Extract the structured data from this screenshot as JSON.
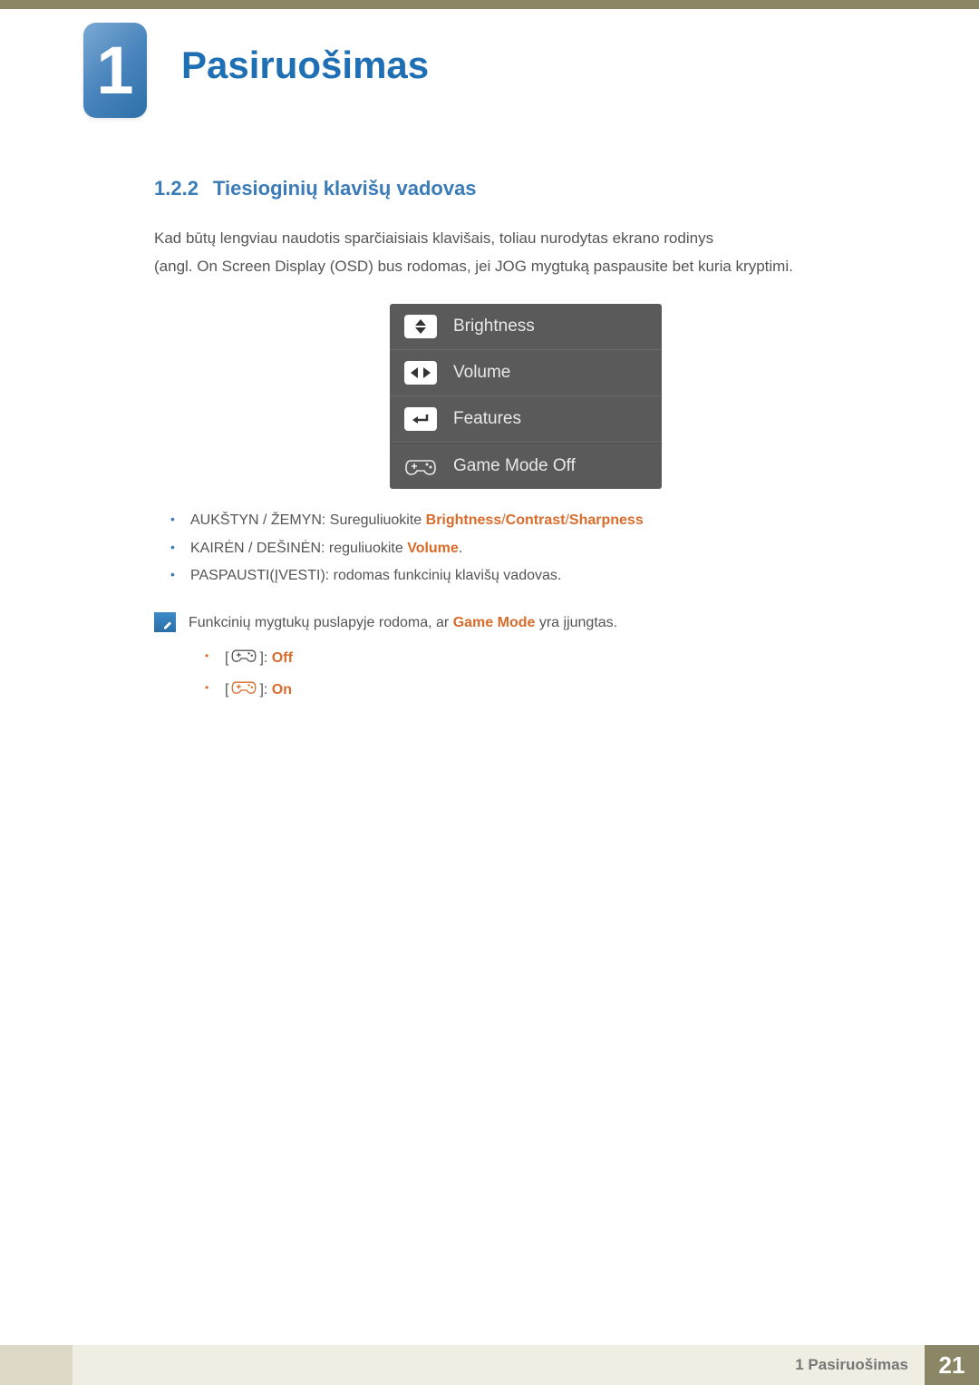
{
  "chapter": {
    "number": "1",
    "title": "Pasiruošimas"
  },
  "section": {
    "number": "1.2.2",
    "title": "Tiesioginių klavišų vadovas"
  },
  "paragraphs": {
    "p1": "Kad būtų lengviau naudotis sparčiaisiais klavišais, toliau nurodytas ekrano rodinys",
    "p2": "(angl. On Screen Display (OSD) bus rodomas, jei JOG mygtuką paspausite bet kuria kryptimi."
  },
  "osd": {
    "brightness": "Brightness",
    "volume": "Volume",
    "features": "Features",
    "gamemode": "Game Mode Off"
  },
  "bullets": {
    "b1_prefix": "AUKŠTYN / ŽEMYN: Sureguliuokite ",
    "b1_h1": "Brightness",
    "b1_s1": "/",
    "b1_h2": "Contrast",
    "b1_s2": "/",
    "b1_h3": "Sharpness",
    "b2_prefix": "KAIRĖN / DEŠINĖN: reguliuokite ",
    "b2_h1": "Volume",
    "b2_suffix": ".",
    "b3": "PASPAUSTI(ĮVESTI): rodomas funkcinių klavišų vadovas."
  },
  "note": {
    "text_prefix": "Funkcinių mygtukų puslapyje rodoma, ar ",
    "text_hl": "Game Mode",
    "text_suffix": " yra įjungtas.",
    "off_bracket_open": "[",
    "off_bracket_close": "]: ",
    "off_label": "Off",
    "on_bracket_open": "[",
    "on_bracket_close": "]: ",
    "on_label": "On"
  },
  "footer": {
    "chapter_ref": "1 Pasiruošimas",
    "page": "21"
  }
}
